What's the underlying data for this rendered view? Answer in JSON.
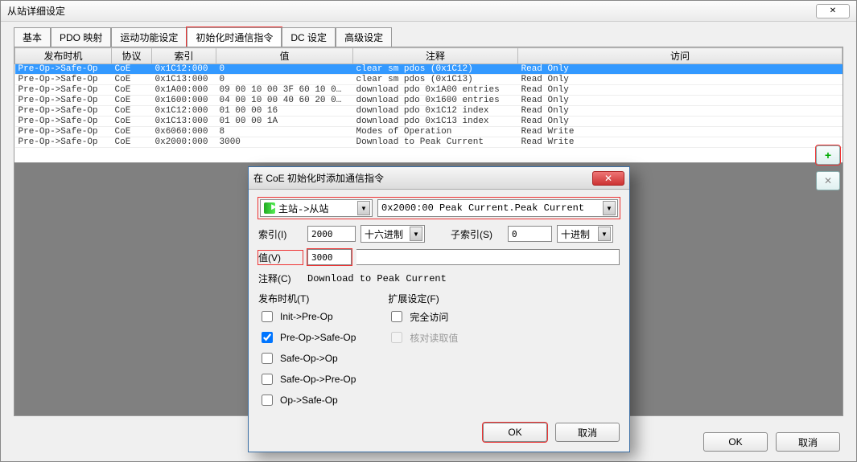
{
  "window": {
    "title": "从站详细设定",
    "close": "✕"
  },
  "tabs": [
    "基本",
    "PDO 映射",
    "运动功能设定",
    "初始化时通信指令",
    "DC 设定",
    "高级设定"
  ],
  "active_tab": 3,
  "table": {
    "headers": [
      "发布时机",
      "协议",
      "索引",
      "值",
      "注释",
      "访问"
    ],
    "rows": [
      {
        "t": "Pre-Op->Safe-Op",
        "p": "CoE",
        "i": "0x1C12:000",
        "v": "0",
        "c": "clear sm pdos (0x1C12)",
        "a": "Read Only",
        "sel": true
      },
      {
        "t": "Pre-Op->Safe-Op",
        "p": "CoE",
        "i": "0x1C13:000",
        "v": "0",
        "c": "clear sm pdos (0x1C13)",
        "a": "Read Only"
      },
      {
        "t": "Pre-Op->Safe-Op",
        "p": "CoE",
        "i": "0x1A00:000",
        "v": "09 00 10 00 3F 60 10 0…",
        "c": "download pdo 0x1A00 entries",
        "a": "Read Only"
      },
      {
        "t": "Pre-Op->Safe-Op",
        "p": "CoE",
        "i": "0x1600:000",
        "v": "04 00 10 00 40 60 20 0…",
        "c": "download pdo 0x1600 entries",
        "a": "Read Only"
      },
      {
        "t": "Pre-Op->Safe-Op",
        "p": "CoE",
        "i": "0x1C12:000",
        "v": "01 00 00 16",
        "c": "download pdo 0x1C12 index",
        "a": "Read Only"
      },
      {
        "t": "Pre-Op->Safe-Op",
        "p": "CoE",
        "i": "0x1C13:000",
        "v": "01 00 00 1A",
        "c": "download pdo 0x1C13 index",
        "a": "Read Only"
      },
      {
        "t": "Pre-Op->Safe-Op",
        "p": "CoE",
        "i": "0x6060:000",
        "v": "8",
        "c": "Modes of Operation",
        "a": "Read Write"
      },
      {
        "t": "Pre-Op->Safe-Op",
        "p": "CoE",
        "i": "0x2000:000",
        "v": "3000",
        "c": "Download to Peak Current",
        "a": "Read Write"
      }
    ]
  },
  "side": {
    "plus": "+",
    "x": "✕"
  },
  "bottom": {
    "ok": "OK",
    "cancel": "取消"
  },
  "dialog": {
    "title": "在 CoE 初始化时添加通信指令",
    "close": "✕",
    "direction": "主站->从站",
    "object": "0x2000:00   Peak Current.Peak Current",
    "index_label": "索引(I)",
    "index_value": "2000",
    "index_radix": "十六进制",
    "sub_label": "子索引(S)",
    "sub_value": "0",
    "sub_radix": "十进制",
    "value_label": "值(V)",
    "value_value": "3000",
    "comment_label": "注释(C)",
    "comment_value": "Download to Peak Current",
    "timing_label": "发布时机(T)",
    "ext_label": "扩展设定(F)",
    "timings": [
      {
        "label": "Init->Pre-Op",
        "checked": false
      },
      {
        "label": "Pre-Op->Safe-Op",
        "checked": true
      },
      {
        "label": "Safe-Op->Op",
        "checked": false
      },
      {
        "label": "Safe-Op->Pre-Op",
        "checked": false
      },
      {
        "label": "Op->Safe-Op",
        "checked": false
      }
    ],
    "ext": [
      {
        "label": "完全访问",
        "checked": false,
        "disabled": false
      },
      {
        "label": "核对读取值",
        "checked": false,
        "disabled": true
      }
    ],
    "ok": "OK",
    "cancel": "取消"
  }
}
